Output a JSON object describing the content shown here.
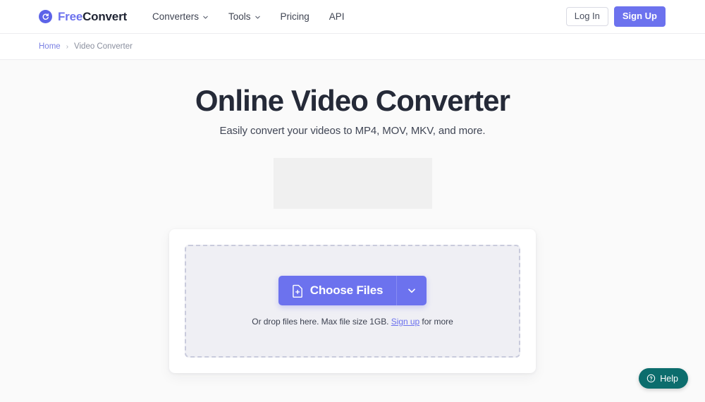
{
  "header": {
    "brand": {
      "icon": "refresh-circle-icon",
      "text_primary": "Free",
      "text_secondary": "Convert"
    },
    "nav": [
      {
        "label": "Converters",
        "has_dropdown": true
      },
      {
        "label": "Tools",
        "has_dropdown": true
      },
      {
        "label": "Pricing",
        "has_dropdown": false
      },
      {
        "label": "API",
        "has_dropdown": false
      }
    ],
    "login_label": "Log In",
    "signup_label": "Sign Up"
  },
  "breadcrumb": {
    "home_label": "Home",
    "separator": "›",
    "current_label": "Video Converter"
  },
  "hero": {
    "title": "Online Video Converter",
    "subtitle": "Easily convert your videos to MP4, MOV, MKV, and more."
  },
  "dropzone": {
    "choose_label": "Choose Files",
    "choose_icon": "file-plus-icon",
    "dropdown_icon": "chevron-down-icon",
    "hint_prefix": "Or drop files here. Max file size 1GB.",
    "hint_link": "Sign up",
    "hint_suffix": "for more"
  },
  "help": {
    "label": "Help",
    "icon": "question-circle-icon"
  },
  "colors": {
    "accent_purple": "#6C72EE",
    "brand_dark": "#1F2433",
    "help_teal": "#0C6D6D",
    "page_bg": "#FAFAFA",
    "dropzone_bg": "#EFEFF4",
    "dropzone_border": "#C9CBDC",
    "ad_placeholder": "#F0F0F0"
  }
}
